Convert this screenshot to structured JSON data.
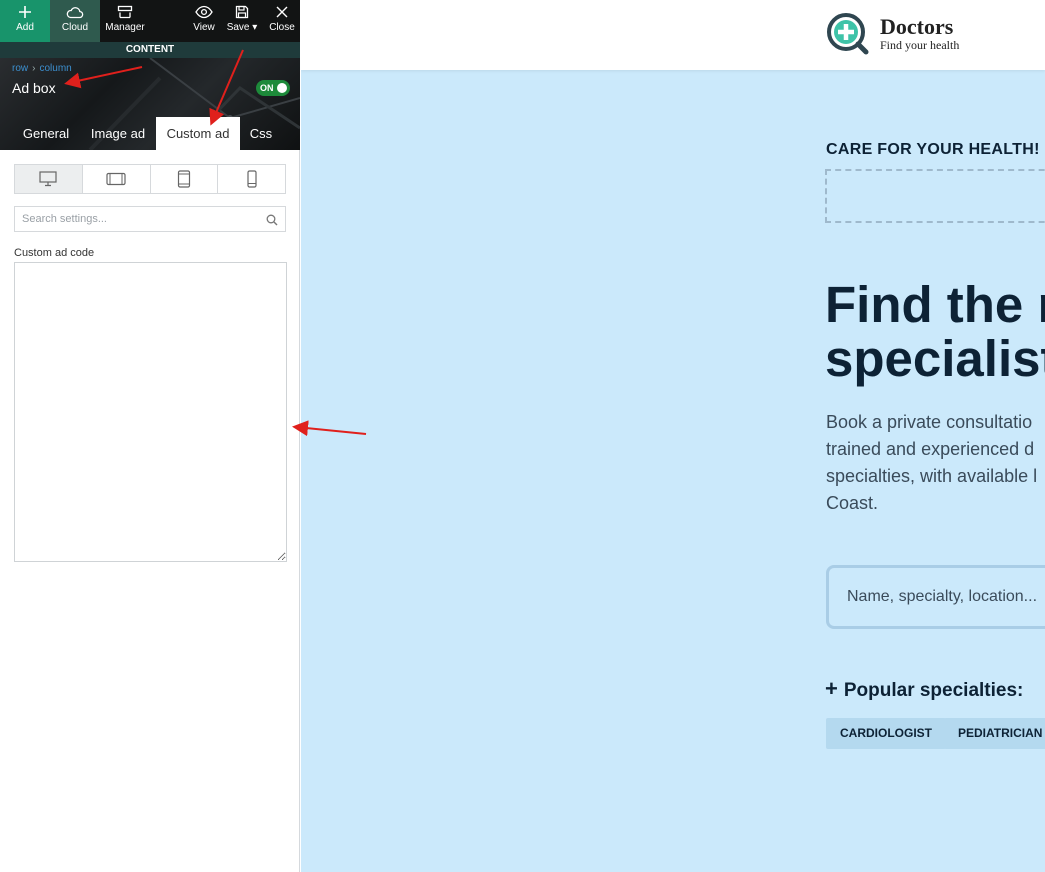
{
  "toolbar": {
    "add": "Add",
    "cloud": "Cloud",
    "manager": "Manager",
    "view": "View",
    "save": "Save",
    "close": "Close"
  },
  "content_bar": "CONTENT",
  "breadcrumb": {
    "row": "row",
    "column": "column"
  },
  "element_title": "Ad box",
  "toggle_label": "ON",
  "tabs": [
    "General",
    "Image ad",
    "Custom ad",
    "Css"
  ],
  "active_tab": "Custom ad",
  "devices": [
    "desktop-icon",
    "tablet-landscape-icon",
    "tablet-portrait-icon",
    "mobile-icon"
  ],
  "search_placeholder": "Search settings...",
  "field_label": "Custom ad code",
  "custom_code_value": "",
  "site": {
    "logo_name": "Doctors",
    "logo_tagline": "Find your health",
    "care_heading": "CARE FOR YOUR HEALTH!",
    "hero_line1": "Find the r",
    "hero_line2": "specialist",
    "description": "Book a private consultatio\ntrained and experienced d\nspecialties, with available l\nCoast.",
    "search_placeholder": "Name, specialty, location...",
    "popular_label": "Popular specialties:",
    "chips": [
      "CARDIOLOGIST",
      "PEDIATRICIAN"
    ]
  },
  "colors": {
    "accent_green": "#18946b",
    "toolbar_bg": "#121414",
    "preview_bg": "#cbe9fb",
    "heading_dark": "#0d2235",
    "annotation_red": "#e0201c"
  }
}
